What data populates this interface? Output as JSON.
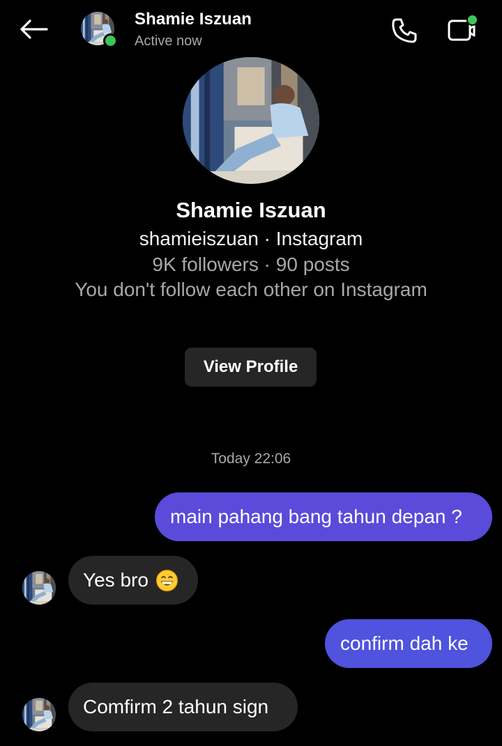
{
  "header": {
    "name": "Shamie Iszuan",
    "status": "Active now",
    "back_icon": "arrow-left-icon",
    "call_icon": "phone-icon",
    "video_icon": "video-camera-icon",
    "online_color": "#3ec55a"
  },
  "profile": {
    "name": "Shamie Iszuan",
    "handle_line": "shamieiszuan · Instagram",
    "stats_line": "9K followers · 90 posts",
    "follow_line": "You don't follow each other on Instagram",
    "view_profile_label": "View Profile"
  },
  "conversation": {
    "timestamp": "Today 22:06",
    "messages": [
      {
        "direction": "sent",
        "text": "main pahang bang tahun depan ?"
      },
      {
        "direction": "received",
        "text": "Yes bro",
        "emoji": "grinning-face-emoji"
      },
      {
        "direction": "sent",
        "text": "confirm dah ke"
      },
      {
        "direction": "received",
        "text": "Comfirm 2 tahun sign"
      }
    ]
  },
  "colors": {
    "background": "#000000",
    "sent_bubble_1": "#5a4bdb",
    "sent_bubble_2": "#4f53dd",
    "received_bubble": "#262626",
    "secondary_text": "#a8a8a8",
    "button_bg": "#262626"
  }
}
